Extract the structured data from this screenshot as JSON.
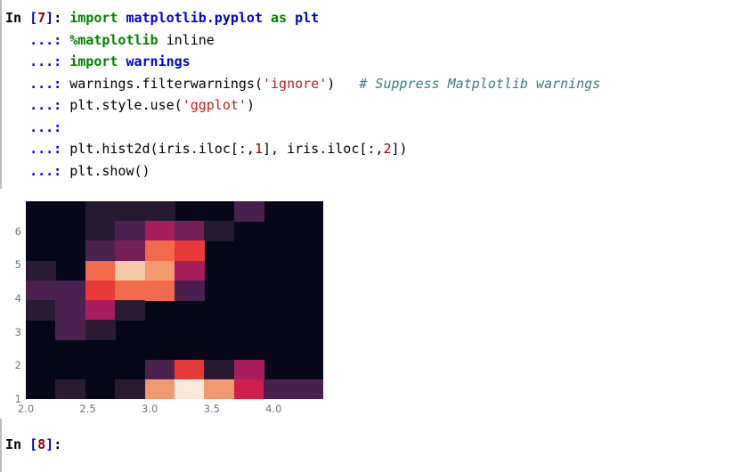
{
  "console": {
    "prompt_in_label": "In",
    "input_number": "7",
    "prompt_open_bracket": "[",
    "prompt_close_bracket": "]",
    "prompt_colon": ":",
    "continuation_prompt": "...:",
    "next_prompt": {
      "label": "In",
      "open_bracket": "[",
      "number": "8",
      "close_bracket": "]",
      "colon": ":"
    },
    "lines": [
      {
        "prompt": "In [7]:",
        "tokens": [
          {
            "t": "import",
            "c": "kw"
          },
          {
            "t": " ",
            "c": "plain"
          },
          {
            "t": "matplotlib.pyplot",
            "c": "mod"
          },
          {
            "t": " ",
            "c": "plain"
          },
          {
            "t": "as",
            "c": "kw"
          },
          {
            "t": " ",
            "c": "plain"
          },
          {
            "t": "plt",
            "c": "mod"
          }
        ]
      },
      {
        "prompt": "   ...:",
        "tokens": [
          {
            "t": "%matplotlib",
            "c": "magic"
          },
          {
            "t": " inline",
            "c": "plain"
          }
        ]
      },
      {
        "prompt": "   ...:",
        "tokens": [
          {
            "t": "import",
            "c": "kw"
          },
          {
            "t": " ",
            "c": "plain"
          },
          {
            "t": "warnings",
            "c": "mod"
          }
        ]
      },
      {
        "prompt": "   ...:",
        "tokens": [
          {
            "t": "warnings.filterwarnings(",
            "c": "plain"
          },
          {
            "t": "'ignore'",
            "c": "str"
          },
          {
            "t": ")",
            "c": "plain"
          },
          {
            "t": "   ",
            "c": "plain"
          },
          {
            "t": "# Suppress Matplotlib warnings",
            "c": "comment"
          }
        ]
      },
      {
        "prompt": "   ...:",
        "tokens": [
          {
            "t": "plt.style.use(",
            "c": "plain"
          },
          {
            "t": "'ggplot'",
            "c": "str"
          },
          {
            "t": ")",
            "c": "plain"
          }
        ]
      },
      {
        "prompt": "   ...:",
        "tokens": []
      },
      {
        "prompt": "   ...:",
        "tokens": [
          {
            "t": "plt.hist2d(iris.iloc[:,",
            "c": "plain"
          },
          {
            "t": "1",
            "c": "number"
          },
          {
            "t": "], iris.iloc[:,",
            "c": "plain"
          },
          {
            "t": "2",
            "c": "number"
          },
          {
            "t": "])",
            "c": "plain"
          }
        ]
      },
      {
        "prompt": "   ...:",
        "tokens": [
          {
            "t": "plt.show()",
            "c": "plain"
          }
        ]
      }
    ]
  },
  "chart_data": {
    "type": "heatmap",
    "title": "",
    "xlabel": "",
    "ylabel": "",
    "colormap": "inferno",
    "grid": false,
    "legend": "none",
    "xlim": [
      2.0,
      4.4
    ],
    "ylim": [
      1.0,
      6.9
    ],
    "xticks": [
      2.0,
      2.5,
      3.0,
      3.5,
      4.0
    ],
    "xtick_labels": [
      "2.0",
      "2.5",
      "3.0",
      "3.5",
      "4.0"
    ],
    "yticks": [
      1,
      2,
      3,
      4,
      5,
      6
    ],
    "ytick_labels": [
      "1",
      "2",
      "3",
      "4",
      "5",
      "6"
    ],
    "nbins_x": 10,
    "nbins_y": 10,
    "x_edges": [
      2.0,
      2.24,
      2.48,
      2.72,
      2.96,
      3.2,
      3.44,
      3.68,
      3.92,
      4.16,
      4.4
    ],
    "y_edges": [
      1.0,
      1.59,
      2.18,
      2.77,
      3.36,
      3.95,
      4.54,
      5.13,
      5.72,
      6.31,
      6.9
    ],
    "axes_bg": "#060819",
    "counts": [
      [
        0,
        0,
        1,
        1,
        1,
        0,
        0,
        2,
        0,
        0
      ],
      [
        0,
        0,
        1,
        2,
        5,
        3,
        1,
        0,
        0,
        0
      ],
      [
        0,
        0,
        2,
        3,
        8,
        11,
        0,
        0,
        0,
        0
      ],
      [
        1,
        0,
        8,
        14,
        9,
        5,
        0,
        0,
        0,
        0
      ],
      [
        2,
        2,
        11,
        8,
        8,
        2,
        0,
        0,
        0,
        0
      ],
      [
        1,
        2,
        5,
        1,
        0,
        0,
        0,
        0,
        0,
        0
      ],
      [
        0,
        2,
        1,
        0,
        0,
        0,
        0,
        0,
        0,
        0
      ],
      [
        0,
        0,
        0,
        0,
        0,
        0,
        0,
        0,
        0,
        0
      ],
      [
        0,
        0,
        0,
        0,
        2,
        11,
        1,
        5,
        0,
        0
      ],
      [
        0,
        1,
        0,
        1,
        9,
        16,
        9,
        12,
        2,
        2
      ]
    ],
    "cell_colors": [
      [
        "#060819",
        "#060819",
        "#251a31",
        "#251a31",
        "#251a31",
        "#060819",
        "#060819",
        "#4a2050",
        "#060819",
        "#060819"
      ],
      [
        "#060819",
        "#060819",
        "#251a31",
        "#4b2150",
        "#a81d5d",
        "#751f5a",
        "#251a31",
        "#060819",
        "#060819",
        "#060819"
      ],
      [
        "#060819",
        "#060819",
        "#4b2150",
        "#751f5a",
        "#f06a4b",
        "#e83b38",
        "#060819",
        "#060819",
        "#060819",
        "#060819"
      ],
      [
        "#2a1b35",
        "#060819",
        "#f06a4b",
        "#f6c8a6",
        "#f2996f",
        "#a81d5d",
        "#060819",
        "#060819",
        "#060819",
        "#060819"
      ],
      [
        "#4b2150",
        "#4b2150",
        "#e83b38",
        "#f06a4b",
        "#f06a4b",
        "#4a2050",
        "#060819",
        "#060819",
        "#060819",
        "#060819"
      ],
      [
        "#2a1b35",
        "#4b2150",
        "#a81d5d",
        "#2a1b35",
        "#060819",
        "#060819",
        "#060819",
        "#060819",
        "#060819",
        "#060819"
      ],
      [
        "#060819",
        "#4b2150",
        "#2a1b35",
        "#060819",
        "#060819",
        "#060819",
        "#060819",
        "#060819",
        "#060819",
        "#060819"
      ],
      [
        "#060819",
        "#060819",
        "#060819",
        "#060819",
        "#060819",
        "#060819",
        "#060819",
        "#060819",
        "#060819",
        "#060819"
      ],
      [
        "#060819",
        "#060819",
        "#060819",
        "#060819",
        "#4b2150",
        "#e83b38",
        "#251a31",
        "#a81d5d",
        "#060819",
        "#060819"
      ],
      [
        "#060819",
        "#2a1b35",
        "#060819",
        "#2a1b35",
        "#f2996f",
        "#fae8da",
        "#f2996f",
        "#cd1e4d",
        "#4a2050",
        "#4a2050"
      ]
    ]
  }
}
